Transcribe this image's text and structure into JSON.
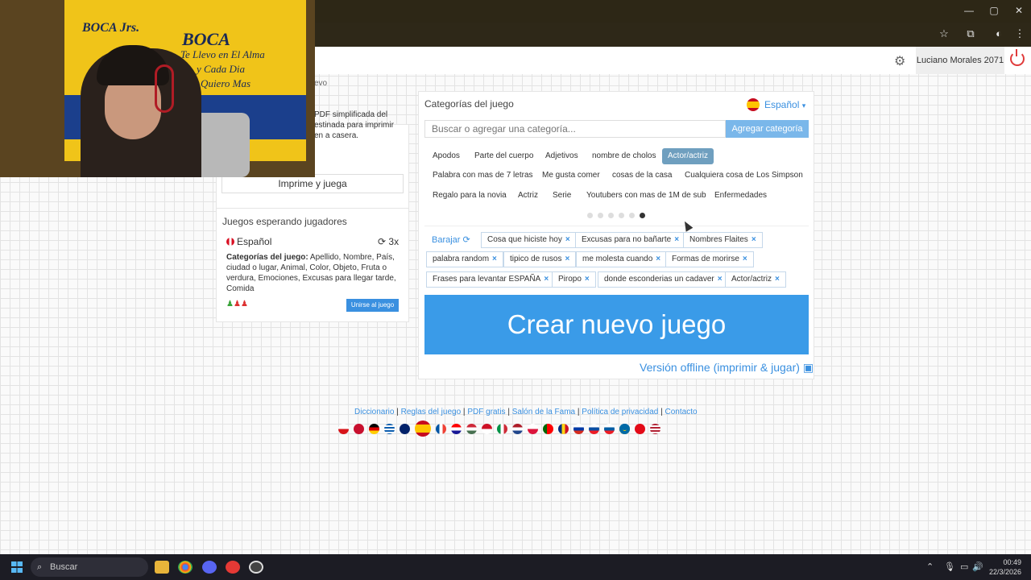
{
  "browser": {
    "window_controls": [
      "—",
      "▢",
      "✕"
    ],
    "toolbar_icons": [
      "star-icon",
      "extensions-icon",
      "profile-icon",
      "menu-icon"
    ]
  },
  "header": {
    "user_name": "Luciano Morales 2071"
  },
  "left_panel": {
    "nuevo_text": "evo",
    "pdf_description": "PDF simplificada del estinada para imprimir en a casera.",
    "print_button": "Imprime y juega"
  },
  "waiting_games": {
    "title": "Juegos esperando jugadores",
    "language": "Español",
    "count": "3x",
    "categories_label": "Categorías del juego:",
    "categories": " Apellido, Nombre, País, ciudad o lugar, Animal, Color, Objeto, Fruta o verdura, Emociones, Excusas para llegar tarde, Comida",
    "join_button": "Unirse al juego",
    "players_colors": [
      "#3aa33a",
      "#d33",
      "#d33"
    ]
  },
  "main": {
    "title": "Categorías del juego",
    "language": "Español",
    "search_placeholder": "Buscar o agregar una categoría...",
    "add_button": "Agregar categoría",
    "suggestions_row1": [
      "Apodos",
      "Parte del cuerpo",
      "Adjetivos",
      "nombre de cholos",
      "Actor/actriz"
    ],
    "suggestions_row2": [
      "Palabra con mas de 7 letras",
      "Me gusta comer",
      "cosas de la casa",
      "Cualquiera cosa de Los Simpson"
    ],
    "suggestions_row3": [
      "Regalo para la novia",
      "Actriz",
      "Serie",
      "Youtubers con mas de 1M de sub",
      "Enfermedades"
    ],
    "active_suggestion": "Actor/actriz",
    "pager_dots": 6,
    "pager_active": 6,
    "shuffle": "Barajar",
    "selected_tags": [
      "Cosa que hiciste hoy",
      "Excusas para no bañarte",
      "Nombres Flaites",
      "palabra random",
      "tipico de rusos",
      "me molesta cuando",
      "Formas de morirse",
      "Frases para levantar ESPAÑA",
      "Piropo",
      "donde esconderias un cadaver",
      "Actor/actriz"
    ],
    "create_button": "Crear nuevo juego",
    "offline_link": "Versión offline (imprimir & jugar)"
  },
  "footer": {
    "links": [
      "Diccionario",
      "Reglas del juego",
      "PDF gratis",
      "Salón de la Fama",
      "Política de privacidad",
      "Contacto"
    ]
  },
  "webcam": {
    "jersey_lines": [
      "BOCA Jrs.",
      "BOCA",
      "Te Llevo en El Alma",
      "y Cada Dia",
      "Te Quiero Mas"
    ]
  },
  "taskbar": {
    "search_placeholder": "Buscar",
    "time": "00:49",
    "date": "22/3/2026"
  }
}
